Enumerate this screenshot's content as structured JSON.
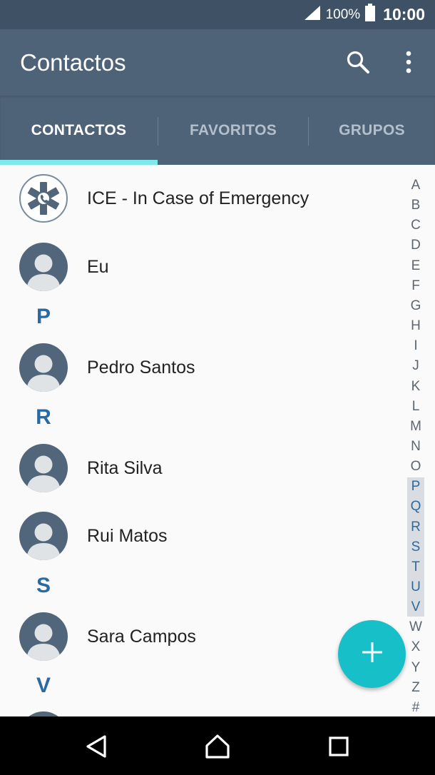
{
  "status_bar": {
    "battery_percent": "100%",
    "time": "10:00"
  },
  "app_bar": {
    "title": "Contactos",
    "icons": [
      "search-icon",
      "more-vert-icon"
    ]
  },
  "tabs": [
    {
      "label": "CONTACTOS",
      "active": true
    },
    {
      "label": "FAVORITOS",
      "active": false
    },
    {
      "label": "GRUPOS",
      "active": false
    }
  ],
  "contacts": {
    "ice": "ICE - In Case of Emergency",
    "me": "Eu",
    "section_p": "P",
    "pedro": "Pedro Santos",
    "section_r": "R",
    "rita": "Rita Silva",
    "rui": "Rui Matos",
    "section_s": "S",
    "sara": "Sara Campos",
    "section_v": "V"
  },
  "alphabet_index": {
    "letters": [
      "A",
      "B",
      "C",
      "D",
      "E",
      "F",
      "G",
      "H",
      "I",
      "J",
      "K",
      "L",
      "M",
      "N",
      "O",
      "P",
      "Q",
      "R",
      "S",
      "T",
      "U",
      "V",
      "W",
      "X",
      "Y",
      "Z",
      "#"
    ],
    "highlighted": [
      "P",
      "Q",
      "R",
      "S",
      "T",
      "U",
      "V"
    ]
  },
  "fab": {
    "icon": "plus-icon"
  },
  "nav_bar": {
    "icons": [
      "back-icon",
      "home-icon",
      "recents-icon"
    ]
  },
  "colors": {
    "status_bar": "#3f5265",
    "app_bar": "#4f6378",
    "tab_indicator": "#7ee8ec",
    "accent": "#17c0c8",
    "section_letter": "#2a6aa1"
  }
}
